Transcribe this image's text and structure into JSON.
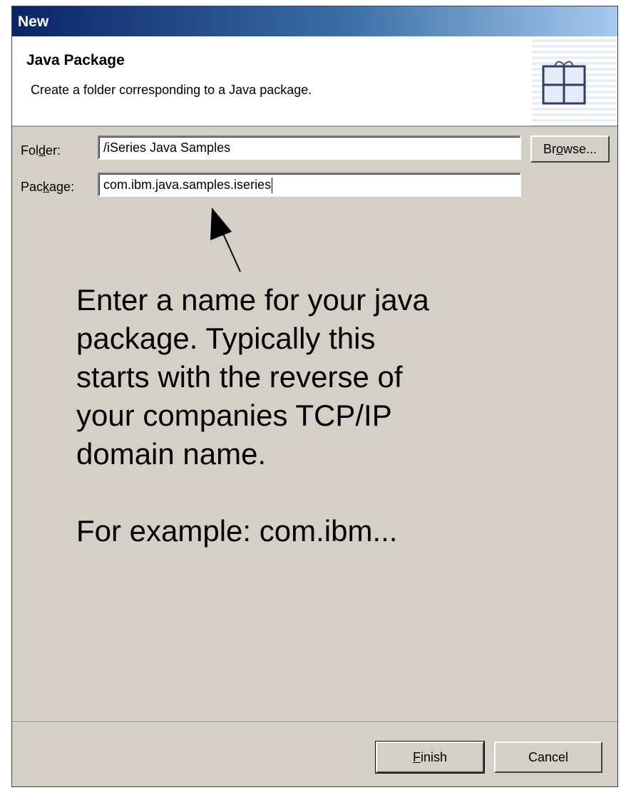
{
  "window": {
    "title": "New"
  },
  "header": {
    "heading": "Java Package",
    "description": "Create a folder corresponding to a Java package.",
    "icon": "package-icon"
  },
  "form": {
    "folder": {
      "label_pre": "Fol",
      "label_mnemonic": "d",
      "label_post": "er:",
      "value": "/iSeries Java Samples"
    },
    "package": {
      "label_pre": "Pac",
      "label_mnemonic": "k",
      "label_post": "age:",
      "value": "com.ibm.java.samples.iseries"
    },
    "browse": {
      "pre": "Br",
      "mnemonic": "o",
      "post": "wse..."
    }
  },
  "annotation": {
    "lines": [
      "Enter a name for your java",
      "package.  Typically this",
      "starts with the reverse of",
      "your companies TCP/IP",
      "domain name."
    ],
    "example": "For example:  com.ibm..."
  },
  "footer": {
    "finish": {
      "mnemonic": "F",
      "rest": "inish"
    },
    "cancel": "Cancel"
  }
}
